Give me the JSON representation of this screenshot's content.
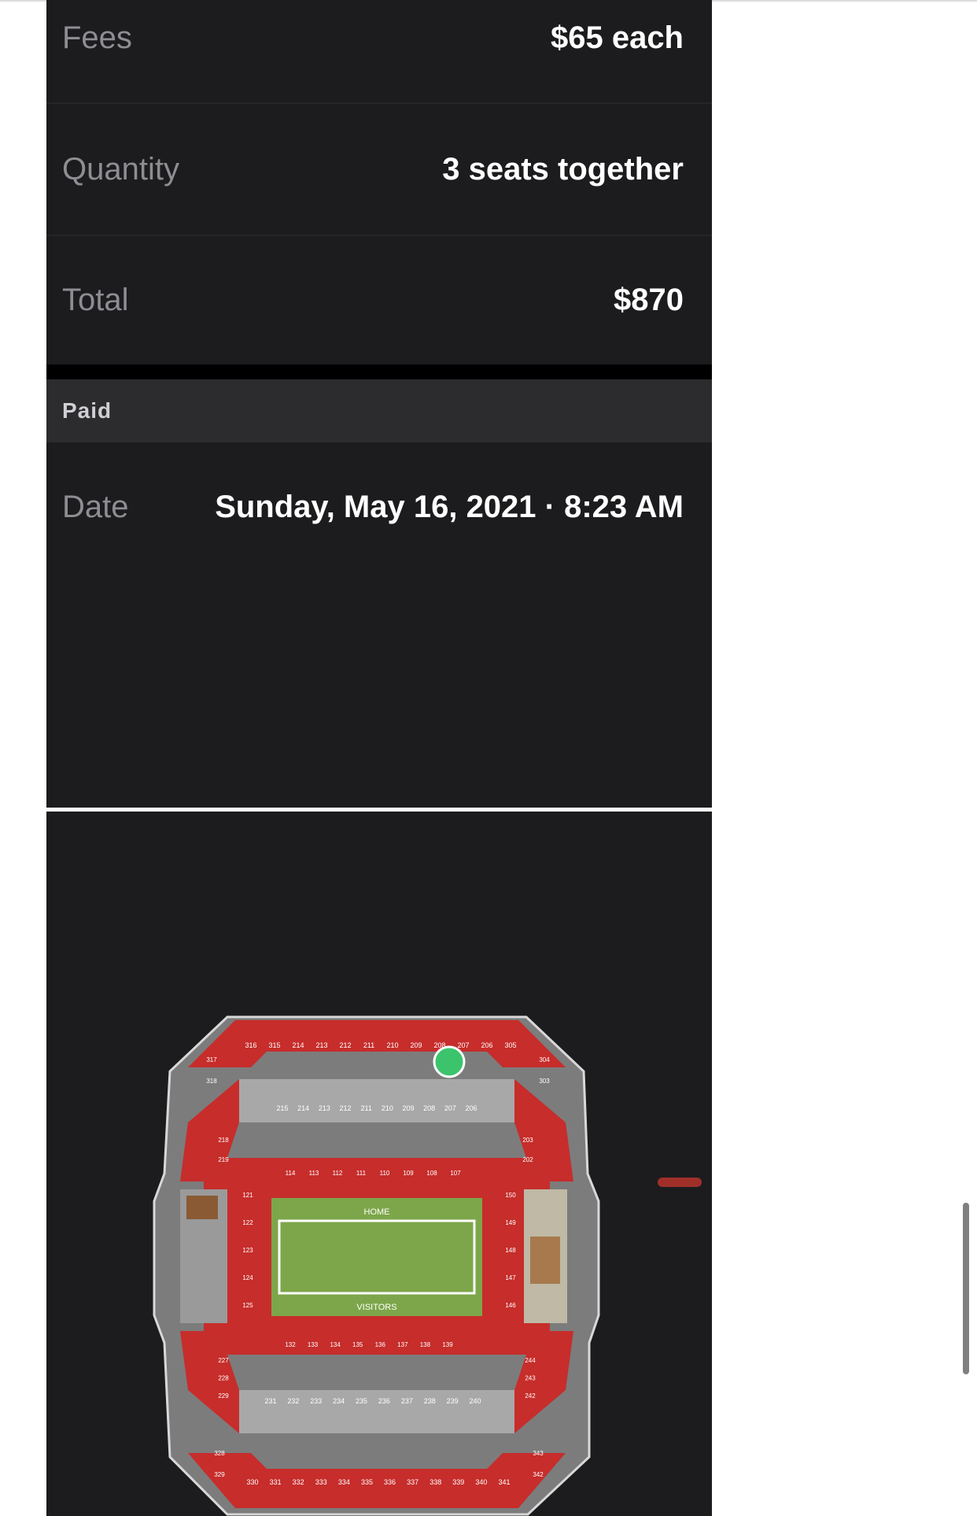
{
  "order": {
    "fees": {
      "label": "Fees",
      "value": "$65 each"
    },
    "quantity": {
      "label": "Quantity",
      "value": "3 seats together"
    },
    "total": {
      "label": "Total",
      "value": "$870"
    }
  },
  "paid_section": {
    "header": "Paid",
    "date": {
      "label": "Date",
      "value": "Sunday, May 16, 2021 · 8:23 AM"
    }
  },
  "seat_map": {
    "field_top_label": "HOME",
    "field_bottom_label": "VISITORS",
    "upper_top_sections": [
      "316",
      "315",
      "214",
      "213",
      "212",
      "211",
      "210",
      "209",
      "208",
      "207",
      "206",
      "305"
    ],
    "club_sections": [
      "215",
      "214",
      "213",
      "212",
      "211",
      "210",
      "209",
      "208",
      "207",
      "206"
    ],
    "lower_top_sections": [
      "114",
      "113",
      "112",
      "111",
      "110",
      "109",
      "108",
      "107"
    ],
    "lower_left_sections": [
      "121",
      "122",
      "123",
      "124",
      "125"
    ],
    "lower_right_sections": [
      "150",
      "149",
      "148",
      "147",
      "146"
    ],
    "lower_bottom_sections": [
      "132",
      "133",
      "134",
      "135",
      "136",
      "137",
      "138",
      "139"
    ],
    "club_bottom_sections": [
      "231",
      "232",
      "233",
      "234",
      "235",
      "236",
      "237",
      "238",
      "239",
      "240"
    ],
    "upper_bottom_sections": [
      "330",
      "331",
      "332",
      "333",
      "334",
      "335",
      "336",
      "337",
      "338",
      "339",
      "340",
      "341"
    ],
    "corner_sections": {
      "top_left": [
        "317",
        "318"
      ],
      "top_right": [
        "304",
        "303"
      ],
      "mid_left": [
        "218",
        "219"
      ],
      "mid_right": [
        "203",
        "202"
      ],
      "bottom_left": [
        "227",
        "228",
        "229"
      ],
      "bottom_right": [
        "244",
        "243",
        "242"
      ],
      "lower_corner_bottom_left": [
        "328",
        "329"
      ],
      "lower_corner_bottom_right": [
        "343",
        "342"
      ]
    },
    "colors": {
      "seat_red": "#c62d2b",
      "seat_red_light": "#e0504a",
      "concourse_gray": "#8f8f8f",
      "field_green": "#7da64a",
      "selected_marker": "#3cc46c"
    },
    "selected_marker_icon": "selected-seat-marker-icon"
  }
}
